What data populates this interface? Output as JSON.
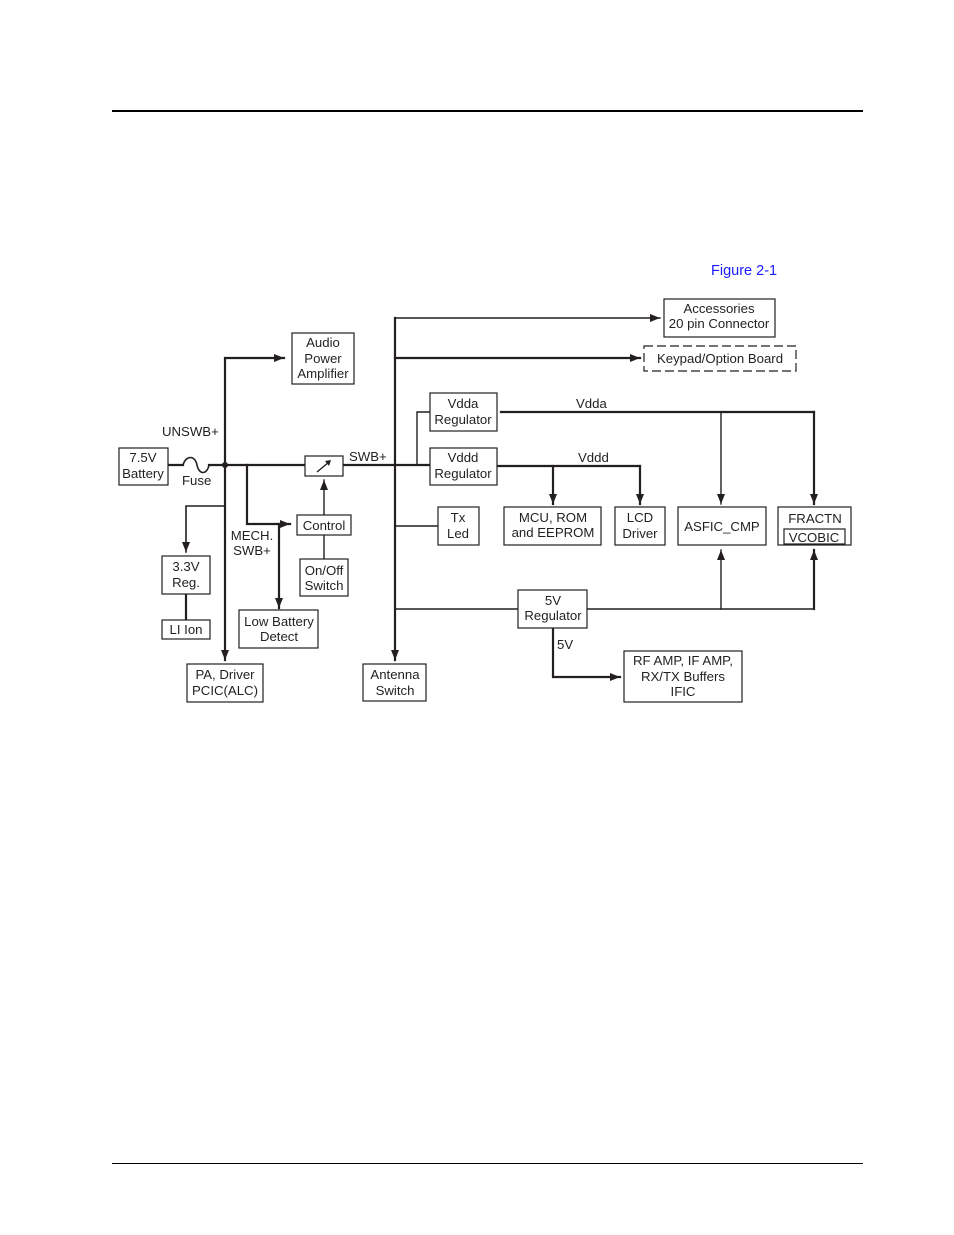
{
  "figure_label": "Figure 2-1",
  "colors": {
    "figure_label": "#1a1aff",
    "ink": "#231f20"
  },
  "blocks": {
    "battery": [
      "7.5V",
      "Battery"
    ],
    "audio_amp": [
      "Audio",
      "Power",
      "Amplifier"
    ],
    "accessories": [
      "Accessories",
      "20 pin Connector"
    ],
    "keypad": [
      "Keypad/Option Board"
    ],
    "vdda_reg": [
      "Vdda",
      "Regulator"
    ],
    "vddd_reg": [
      "Vddd",
      "Regulator"
    ],
    "control": [
      "Control"
    ],
    "onoff": [
      "On/Off",
      "Switch"
    ],
    "reg33": [
      "3.3V",
      "Reg."
    ],
    "liion": [
      "LI Ion"
    ],
    "lowbatt": [
      "Low Battery",
      "Detect"
    ],
    "pa_driver": [
      "PA, Driver",
      "PCIC(ALC)"
    ],
    "txled": [
      "Tx",
      "Led"
    ],
    "mcu": [
      "MCU, ROM",
      "and EEPROM"
    ],
    "lcd": [
      "LCD",
      "Driver"
    ],
    "asfic": [
      "ASFIC_CMP"
    ],
    "fractn": [
      "FRACTN"
    ],
    "vcobic": [
      "VCOBIC"
    ],
    "reg5v": [
      "5V",
      "Regulator"
    ],
    "antenna": [
      "Antenna",
      "Switch"
    ],
    "rf": [
      "RF AMP, IF AMP,",
      "RX/TX Buffers",
      "IFIC"
    ]
  },
  "labels": {
    "unswb": "UNSWB+",
    "fuse": "Fuse",
    "swb": "SWB+",
    "mech": [
      "MECH.",
      "SWB+"
    ],
    "vdda": "Vdda",
    "vddd": "Vddd",
    "v5": "5V"
  }
}
